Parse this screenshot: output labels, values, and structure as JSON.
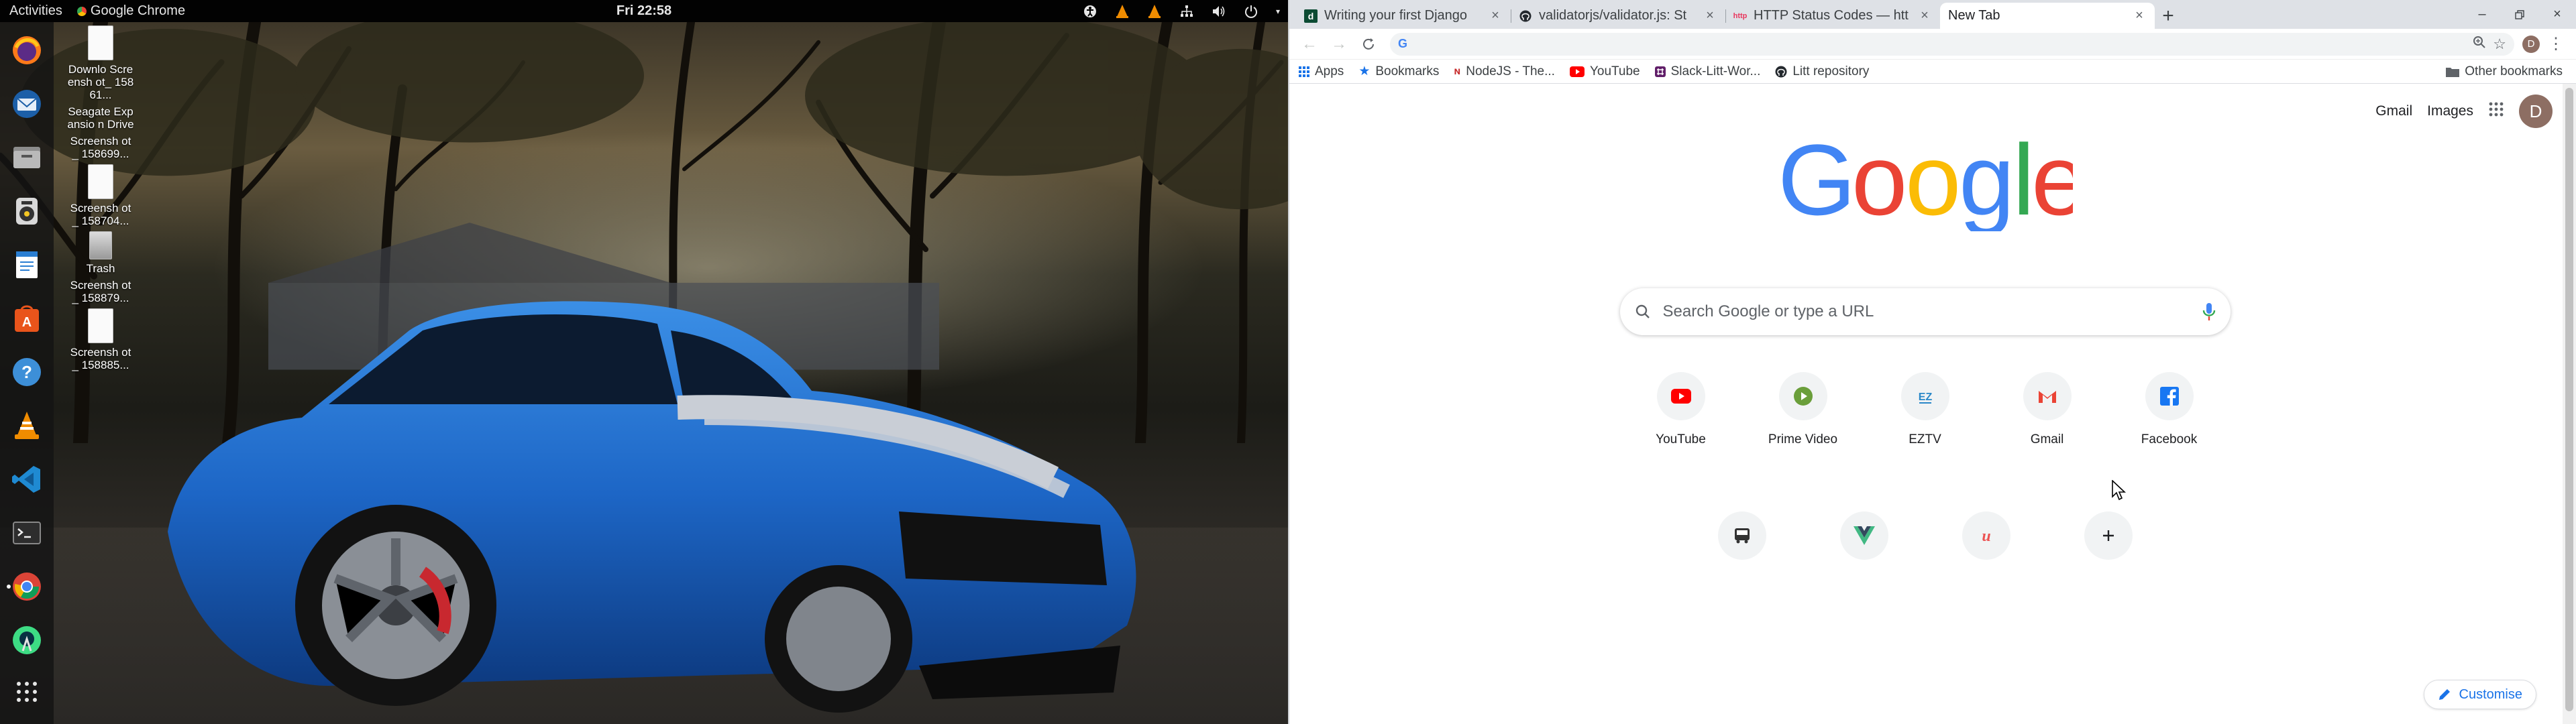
{
  "topbar": {
    "activities": "Activities",
    "app_menu": "Google Chrome",
    "clock": "Fri 22:58"
  },
  "dock": {
    "items": [
      "firefox-icon",
      "thunderbird-icon",
      "files-icon",
      "rhythmbox-icon",
      "writer-icon",
      "software-icon",
      "help-icon",
      "vlc-icon",
      "vscode-icon",
      "terminal-icon",
      "chrome-icon",
      "android-studio-icon"
    ]
  },
  "desktop": {
    "icons": [
      {
        "label": "Downlo Screensh ot_ 15861..."
      },
      {
        "label": "Seagate Expansio n Drive"
      },
      {
        "label": "Screensh ot_ 158699..."
      },
      {
        "label": "Screensh ot_ 158704..."
      },
      {
        "label": "Trash"
      },
      {
        "label": "Screensh ot_ 158879..."
      },
      {
        "label": "Screensh ot_ 158885..."
      }
    ]
  },
  "chrome": {
    "tabs": [
      {
        "title": "Writing your first Django",
        "active": false
      },
      {
        "title": "validatorjs/validator.js: St",
        "active": false
      },
      {
        "title": "HTTP Status Codes — htt",
        "active": false
      },
      {
        "title": "New Tab",
        "active": true
      }
    ],
    "omnibox": {
      "value": ""
    },
    "bookmarks": [
      {
        "label": "Apps"
      },
      {
        "label": "Bookmarks"
      },
      {
        "label": "NodeJS - The..."
      },
      {
        "label": "YouTube"
      },
      {
        "label": "Slack-Litt-Wor..."
      },
      {
        "label": "Litt repository"
      }
    ],
    "other_bookmarks": "Other bookmarks",
    "profile_initial": "D"
  },
  "ntp": {
    "gmail": "Gmail",
    "images": "Images",
    "avatar_initial": "D",
    "search_placeholder": "Search Google or type a URL",
    "shortcuts": [
      {
        "label": "YouTube",
        "icon": "youtube-icon"
      },
      {
        "label": "Prime Video",
        "icon": "prime-video-icon"
      },
      {
        "label": "EZTV",
        "icon": "eztv-icon"
      },
      {
        "label": "Gmail",
        "icon": "gmail-icon"
      },
      {
        "label": "Facebook",
        "icon": "facebook-icon"
      },
      {
        "label": "",
        "icon": "bus-icon"
      },
      {
        "label": "",
        "icon": "vue-icon"
      },
      {
        "label": "",
        "icon": "udemy-icon"
      },
      {
        "label": "",
        "icon": "add-shortcut-icon"
      }
    ],
    "customise": "Customise"
  },
  "colors": {
    "google_blue": "#4285F4",
    "google_red": "#EA4335",
    "google_yellow": "#FBBC05",
    "google_green": "#34A853",
    "link_blue": "#1a73e8"
  }
}
